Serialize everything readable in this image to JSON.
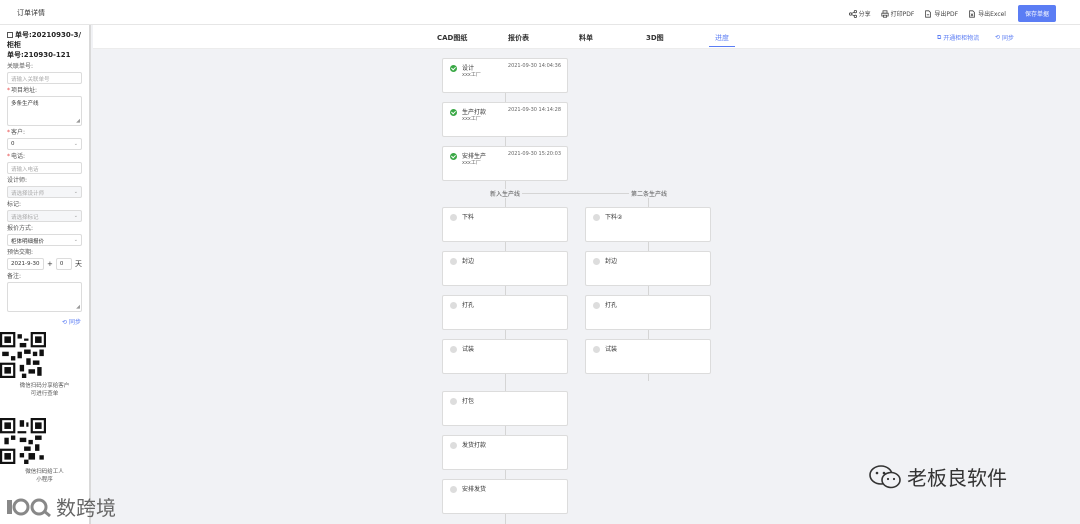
{
  "header": {
    "title": "订单详情",
    "actions": [
      {
        "label": "分享",
        "icon": "share-icon"
      },
      {
        "label": "打印PDF",
        "icon": "printer-icon"
      },
      {
        "label": "导出PDF",
        "icon": "pdf-icon"
      },
      {
        "label": "导出Excel",
        "icon": "excel-icon"
      }
    ],
    "save_label": "保存单据"
  },
  "sidebar": {
    "order_line1": "单号:20210930-3/柜柜",
    "order_line2": "单号:210930-121",
    "related_label": "关联单号:",
    "related_placeholder": "请输入关联单号",
    "project_label": "项目地址:",
    "project_value": "多条生产线",
    "customer_label": "客户:",
    "customer_value": "0",
    "phone_label": "电话:",
    "phone_placeholder": "请输入电话",
    "designer_label": "设计师:",
    "designer_placeholder": "请选择设计师",
    "mark_label": "标记:",
    "mark_placeholder": "请选择标记",
    "quote_label": "报价方式:",
    "quote_value": "柜体明细报价",
    "delivery_label": "预估交期:",
    "delivery_date": "2021-9-30",
    "delivery_plus": "+",
    "delivery_days": "0",
    "delivery_unit": "天",
    "remark_label": "备注:",
    "sync_label": "同步",
    "qr1_caption_1": "微信扫码分享给客户",
    "qr1_caption_2": "可进行查单",
    "qr2_caption_1": "微信扫码给工人",
    "qr2_caption_2": "小程序"
  },
  "tabs": {
    "items": [
      {
        "label": "CAD图纸",
        "active": false
      },
      {
        "label": "报价表",
        "active": false
      },
      {
        "label": "料单",
        "active": false
      },
      {
        "label": "3D图",
        "active": false
      },
      {
        "label": "进度",
        "active": true
      }
    ],
    "open_cabinet": "开通柜柜物流",
    "sync": "同步"
  },
  "progress": {
    "top_steps": [
      {
        "name": "设计",
        "sub": "xxx工厂",
        "time": "2021-09-30 14:04:36",
        "done": true
      },
      {
        "name": "生产打款",
        "sub": "xxx工厂",
        "time": "2021-09-30 14:14:28",
        "done": true
      },
      {
        "name": "安排生产",
        "sub": "xxx工厂",
        "time": "2021-09-30 15:20:03",
        "done": true
      }
    ],
    "line1_label": "新入生产线",
    "line2_label": "第二条生产线",
    "line1_steps": [
      "下料",
      "封边",
      "打孔",
      "试装",
      "打包",
      "发货打款",
      "安排发货"
    ],
    "line2_steps": [
      "下料②",
      "封边",
      "打孔",
      "试装"
    ]
  },
  "watermarks": {
    "brand": "老板良软件",
    "corner": "数跨境"
  },
  "colors": {
    "accent": "#5b7df4",
    "done": "#39a845",
    "required": "#e64545"
  }
}
